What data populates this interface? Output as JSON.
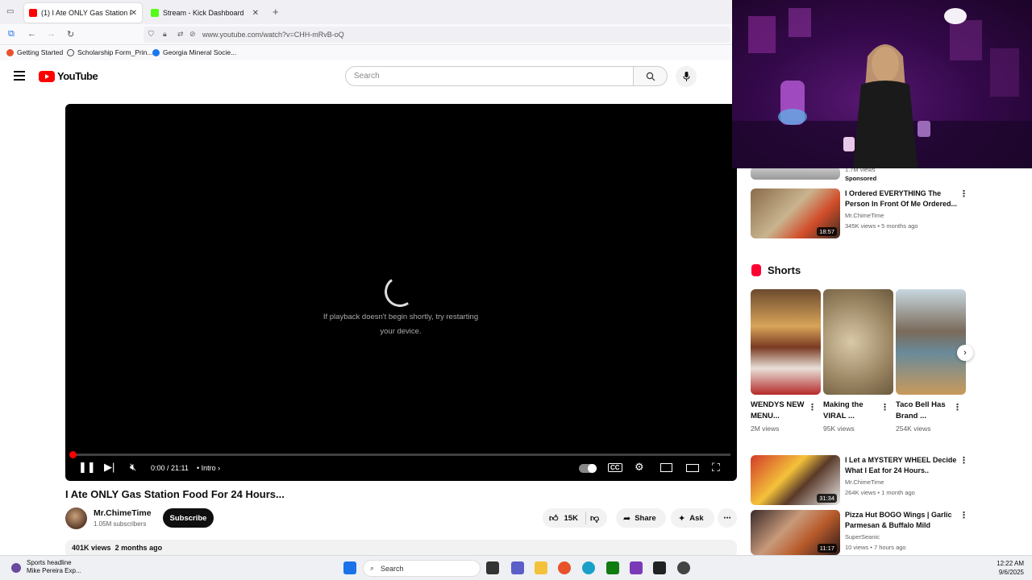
{
  "browser": {
    "tabs": [
      {
        "label": "(1) I Ate ONLY Gas Station Food",
        "active": true,
        "favicon_color": "#ff0000"
      },
      {
        "label": "Stream - Kick Dashboard",
        "active": false,
        "favicon_color": "#53fc18"
      }
    ],
    "new_tab": "+",
    "close_glyph": "✕",
    "url": "www.youtube.com/watch?v=CHH-mRvB-oQ",
    "bookmarks": [
      "Getting Started",
      "Scholarship Form_Prin...",
      "Georgia Mineral Socie..."
    ]
  },
  "youtube": {
    "logo_text": "YouTube",
    "search_placeholder": "Search"
  },
  "player": {
    "message": "If playback doesn't begin shortly, try restarting your device.",
    "time": "0:00 / 21:11",
    "chapter": "• Intro",
    "progress": 0.0
  },
  "video": {
    "title": "I Ate ONLY Gas Station Food For 24 Hours...",
    "channel": "Mr.ChimeTime",
    "subscribers": "1.05M subscribers",
    "subscribe_label": "Subscribe",
    "likes": "15K",
    "share_label": "Share",
    "ask_label": "Ask",
    "views": "401K views",
    "date": "2 months ago"
  },
  "sidebar": {
    "top_partial": {
      "meta": "1.7M views",
      "sponsored": "Sponsored"
    },
    "recs": [
      {
        "title": "I Ordered EVERYTHING The Person In Front Of Me Ordered...",
        "channel": "Mr.ChimeTime",
        "meta": "345K views • 5 months ago",
        "duration": "18:57"
      },
      {
        "title": "I Let a MYSTERY WHEEL Decide What I Eat for 24 Hours..",
        "channel": "Mr.ChimeTime",
        "meta": "264K views • 1 month ago",
        "duration": "31:34"
      },
      {
        "title": "Pizza Hut BOGO Wings | Garlic Parmesan & Buffalo Mild",
        "channel": "SuperSeanic",
        "meta": "10 views • 7 hours ago",
        "duration": "11:17"
      }
    ],
    "shorts_heading": "Shorts",
    "shorts": [
      {
        "title": "WENDYS NEW MENU...",
        "views": "2M views"
      },
      {
        "title": "Making the VIRAL ...",
        "views": "95K views"
      },
      {
        "title": "Taco Bell Has Brand ...",
        "views": "254K views"
      }
    ]
  },
  "taskbar": {
    "news_title": "Sports headline",
    "news_sub": "Mike Pereira Exp...",
    "search_label": "Search",
    "time": "12:22 AM",
    "date": "9/6/2025"
  }
}
